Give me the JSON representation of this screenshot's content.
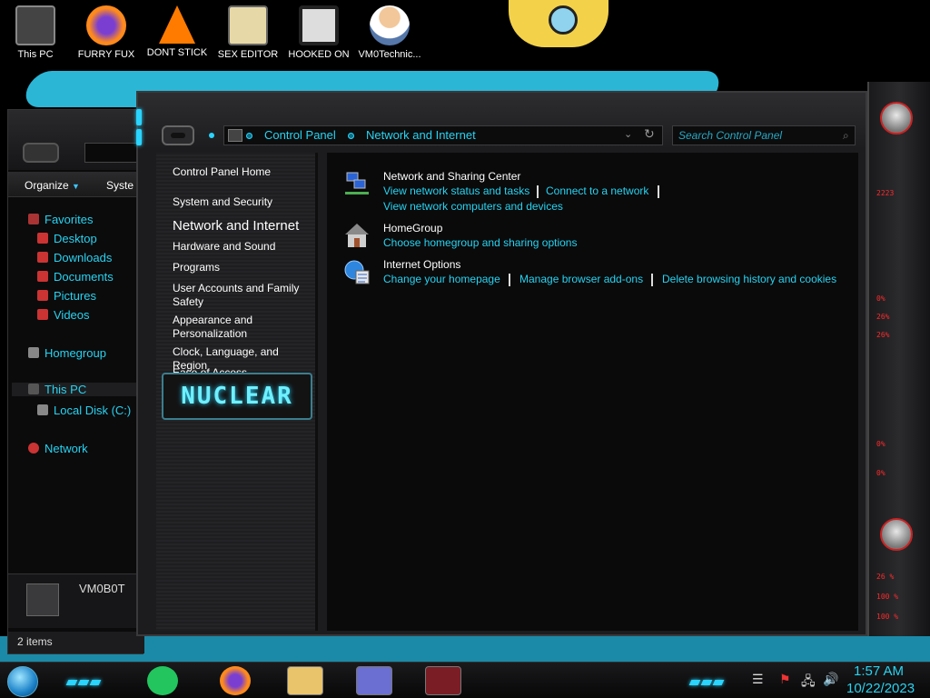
{
  "desktop": {
    "icons": [
      {
        "label": "This PC"
      },
      {
        "label": "FURRY FUX"
      },
      {
        "label": "DONT STICK"
      },
      {
        "label": "SEX EDITOR"
      },
      {
        "label": "HOOKED ON"
      },
      {
        "label": "VM0Technic..."
      }
    ]
  },
  "explorer_back": {
    "organize": "Organize",
    "system_tab": "Syste",
    "nav": {
      "favorites": "Favorites",
      "desktop": "Desktop",
      "downloads": "Downloads",
      "documents": "Documents",
      "pictures": "Pictures",
      "videos": "Videos",
      "homegroup": "Homegroup",
      "this_pc": "This PC",
      "local_disk": "Local Disk (C:)",
      "network": "Network"
    },
    "user": "VM0B0T",
    "status": "2 items"
  },
  "control_panel": {
    "breadcrumb": [
      "Control Panel",
      "Network and Internet"
    ],
    "search_placeholder": "Search Control Panel",
    "side_links": {
      "home": "Control Panel Home",
      "system_security": "System and Security",
      "network_internet": "Network and Internet",
      "hardware_sound": "Hardware and Sound",
      "programs": "Programs",
      "user_accounts": "User Accounts and Family Safety",
      "appearance": "Appearance and Personalization",
      "clock": "Clock, Language, and Region",
      "ease": "Ease of Access"
    },
    "banner": "NUCLEAR",
    "categories": {
      "sharing": {
        "title": "Network and Sharing Center",
        "links": [
          "View network status and tasks",
          "Connect to a network",
          "View network computers and devices"
        ]
      },
      "homegroup": {
        "title": "HomeGroup",
        "links": [
          "Choose homegroup and sharing options"
        ]
      },
      "internet": {
        "title": "Internet Options",
        "links": [
          "Change your homepage",
          "Manage browser add-ons",
          "Delete browsing history and cookies"
        ]
      }
    }
  },
  "gadget": {
    "readouts": [
      "2223",
      "0%",
      "26%",
      "26%",
      "0%",
      "0%",
      "26 %",
      "100 %",
      "100 %"
    ]
  },
  "taskbar": {
    "time": "1:57 AM",
    "date": "10/22/2023"
  },
  "colors": {
    "accent": "#27d3f0",
    "background": "#000000",
    "panel": "#1c1c1e"
  }
}
